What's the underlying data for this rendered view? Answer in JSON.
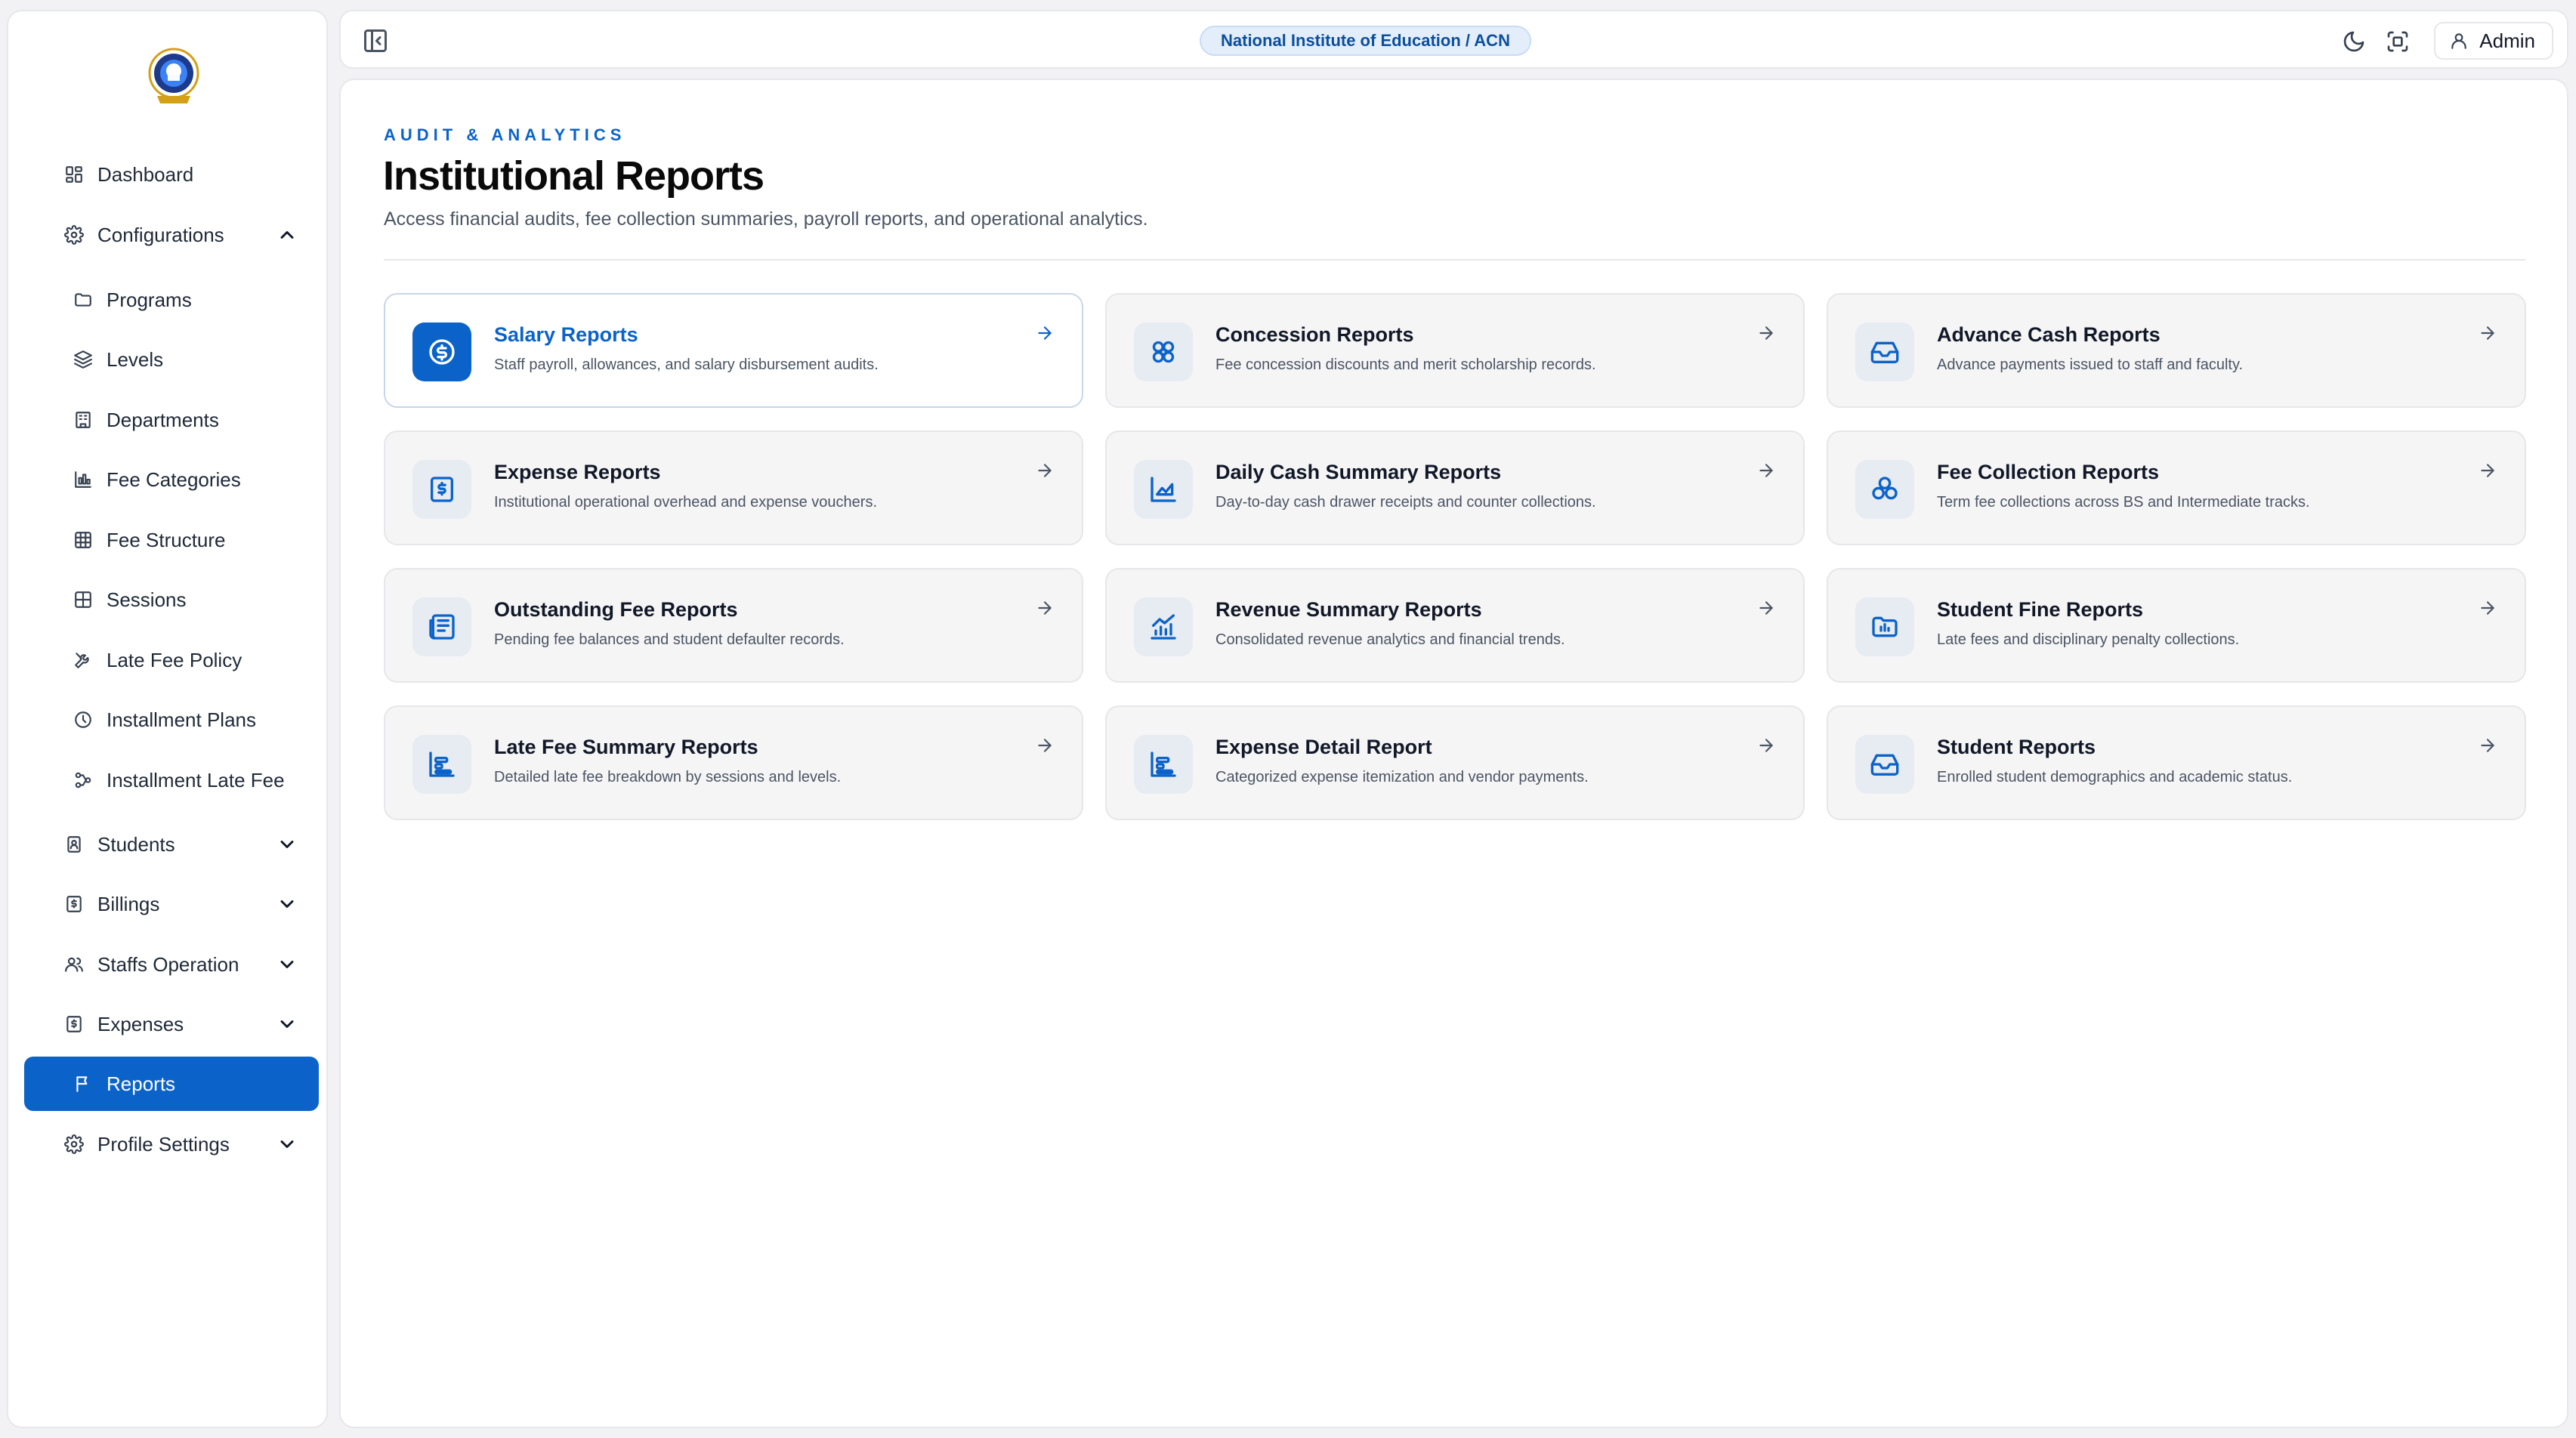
{
  "colors": {
    "accent": "#0b63c9",
    "background": "#f2f2f4",
    "card": "#f5f5f6"
  },
  "sidebar": {
    "logo": "institution-logo",
    "items": [
      {
        "label": "Dashboard",
        "icon": "grid-icon",
        "level": "top",
        "chevron": ""
      },
      {
        "label": "Configurations",
        "icon": "gear-icon",
        "level": "top",
        "chevron": "up"
      },
      {
        "label": "Programs",
        "icon": "folder-icon",
        "level": "sub"
      },
      {
        "label": "Levels",
        "icon": "layers-icon",
        "level": "sub"
      },
      {
        "label": "Departments",
        "icon": "building-icon",
        "level": "sub"
      },
      {
        "label": "Fee Categories",
        "icon": "bar-chart-icon",
        "level": "sub"
      },
      {
        "label": "Fee Structure",
        "icon": "table-icon",
        "level": "sub"
      },
      {
        "label": "Sessions",
        "icon": "grid-square-icon",
        "level": "sub"
      },
      {
        "label": "Late Fee Policy",
        "icon": "tools-icon",
        "level": "sub"
      },
      {
        "label": "Installment Plans",
        "icon": "pie-icon",
        "level": "sub"
      },
      {
        "label": "Installment Late Fee",
        "icon": "nodes-icon",
        "level": "sub"
      },
      {
        "label": "Students",
        "icon": "id-card-icon",
        "level": "top",
        "chevron": "down"
      },
      {
        "label": "Billings",
        "icon": "dollar-doc-icon",
        "level": "top",
        "chevron": "down"
      },
      {
        "label": "Staffs Operation",
        "icon": "users-icon",
        "level": "top",
        "chevron": "down"
      },
      {
        "label": "Expenses",
        "icon": "dollar-doc-icon",
        "level": "top",
        "chevron": "down"
      },
      {
        "label": "Reports",
        "icon": "flag-icon",
        "level": "sub",
        "active": true
      },
      {
        "label": "Profile Settings",
        "icon": "gear-icon",
        "level": "top",
        "chevron": "down"
      }
    ]
  },
  "topbar": {
    "institution": "National Institute of Education / ACN",
    "user": "Admin"
  },
  "header": {
    "eyebrow": "AUDIT & ANALYTICS",
    "title": "Institutional Reports",
    "subtitle": "Access financial audits, fee collection summaries, payroll reports, and operational analytics."
  },
  "reports": [
    {
      "title": "Salary Reports",
      "desc": "Staff payroll, allowances, and salary disbursement audits.",
      "icon": "dollar-circle-icon",
      "selected": true
    },
    {
      "title": "Concession Reports",
      "desc": "Fee concession discounts and merit scholarship records.",
      "icon": "badge-icon"
    },
    {
      "title": "Advance Cash Reports",
      "desc": "Advance payments issued to staff and faculty.",
      "icon": "inbox-icon"
    },
    {
      "title": "Expense Reports",
      "desc": "Institutional operational overhead and expense vouchers.",
      "icon": "dollar-doc-icon"
    },
    {
      "title": "Daily Cash Summary Reports",
      "desc": "Day-to-day cash drawer receipts and counter collections.",
      "icon": "area-chart-icon"
    },
    {
      "title": "Fee Collection Reports",
      "desc": "Term fee collections across BS and Intermediate tracks.",
      "icon": "coins-icon"
    },
    {
      "title": "Outstanding Fee Reports",
      "desc": "Pending fee balances and student defaulter records.",
      "icon": "newspaper-icon"
    },
    {
      "title": "Revenue Summary Reports",
      "desc": "Consolidated revenue analytics and financial trends.",
      "icon": "trend-chart-icon"
    },
    {
      "title": "Student Fine Reports",
      "desc": "Late fees and disciplinary penalty collections.",
      "icon": "folder-chart-icon"
    },
    {
      "title": "Late Fee Summary Reports",
      "desc": "Detailed late fee breakdown by sessions and levels.",
      "icon": "gantt-icon"
    },
    {
      "title": "Expense Detail Report",
      "desc": "Categorized expense itemization and vendor payments.",
      "icon": "gantt-icon"
    },
    {
      "title": "Student Reports",
      "desc": "Enrolled student demographics and academic status.",
      "icon": "inbox-icon"
    }
  ]
}
